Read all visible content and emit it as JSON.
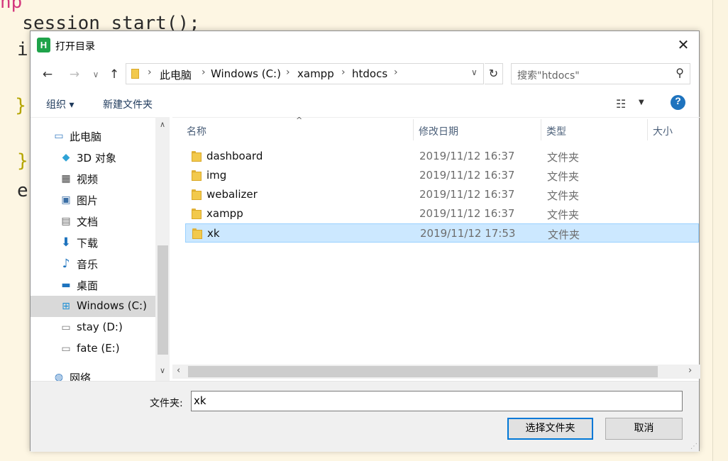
{
  "editor": {
    "lines": [
      "hp",
      "  session_start();",
      "i",
      "  }",
      "}",
      "e"
    ],
    "colors": {
      "keyword": "#d3367c",
      "text": "#2b2b2b",
      "brace": "#b5a500"
    }
  },
  "dialog": {
    "title": "打开目录",
    "app_icon_letter": "H",
    "close_icon": "✕",
    "nav": {
      "back": "←",
      "forward": "→",
      "recent": "∨",
      "up": "↑"
    },
    "address": {
      "crumbs": [
        "此电脑",
        "Windows (C:)",
        "xampp",
        "htdocs"
      ],
      "separator": "›",
      "dropdown": "∨",
      "refresh": "↻"
    },
    "search": {
      "placeholder": "搜索\"htdocs\"",
      "icon": "⚲"
    },
    "toolbar": {
      "organize": "组织 ▾",
      "new_folder": "新建文件夹",
      "help": "?"
    },
    "nav_pane": {
      "items": [
        {
          "label": "此电脑",
          "icon": "pc-icon"
        },
        {
          "label": "3D 对象",
          "icon": "3d-objects-icon"
        },
        {
          "label": "视频",
          "icon": "video-icon"
        },
        {
          "label": "图片",
          "icon": "pictures-icon"
        },
        {
          "label": "文档",
          "icon": "documents-icon"
        },
        {
          "label": "下载",
          "icon": "download-icon"
        },
        {
          "label": "音乐",
          "icon": "music-icon"
        },
        {
          "label": "桌面",
          "icon": "desktop-icon"
        },
        {
          "label": "Windows (C:)",
          "icon": "windows-drive-icon",
          "selected": true
        },
        {
          "label": "stay (D:)",
          "icon": "drive-icon"
        },
        {
          "label": "fate (E:)",
          "icon": "drive-icon"
        },
        {
          "label": "网络",
          "icon": "network-icon"
        }
      ]
    },
    "columns": {
      "name": "名称",
      "date": "修改日期",
      "type": "类型",
      "size": "大小"
    },
    "files": [
      {
        "name": "dashboard",
        "date": "2019/11/12 16:37",
        "type": "文件夹"
      },
      {
        "name": "img",
        "date": "2019/11/12 16:37",
        "type": "文件夹"
      },
      {
        "name": "webalizer",
        "date": "2019/11/12 16:37",
        "type": "文件夹"
      },
      {
        "name": "xampp",
        "date": "2019/11/12 16:37",
        "type": "文件夹"
      },
      {
        "name": "xk",
        "date": "2019/11/12 17:53",
        "type": "文件夹",
        "selected": true
      }
    ],
    "footer": {
      "folder_label": "文件夹:",
      "folder_value": "xk",
      "select_button": "选择文件夹",
      "cancel_button": "取消"
    }
  }
}
